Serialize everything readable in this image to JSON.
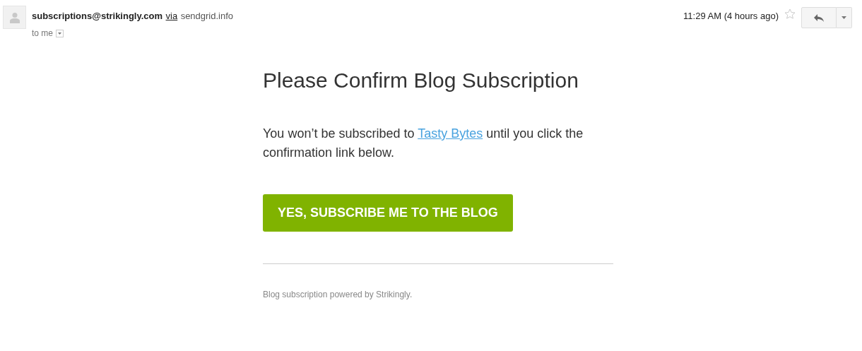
{
  "header": {
    "sender": "subscriptions@strikingly.com",
    "via": "via",
    "relay": "sendgrid.info",
    "recipient": "to me",
    "time": "11:29 AM (4 hours ago)",
    "starred": false
  },
  "email": {
    "title": "Please Confirm Blog Subscription",
    "message": [
      {
        "kind": "text",
        "text": "You won’t be subscribed to "
      },
      {
        "kind": "link",
        "text": "Tasty Bytes"
      },
      {
        "kind": "text",
        "text": " until you click the confirmation link below."
      }
    ],
    "button": "YES, SUBSCRIBE ME TO THE BLOG",
    "footer": "Blog subscription powered by Strikingly."
  }
}
